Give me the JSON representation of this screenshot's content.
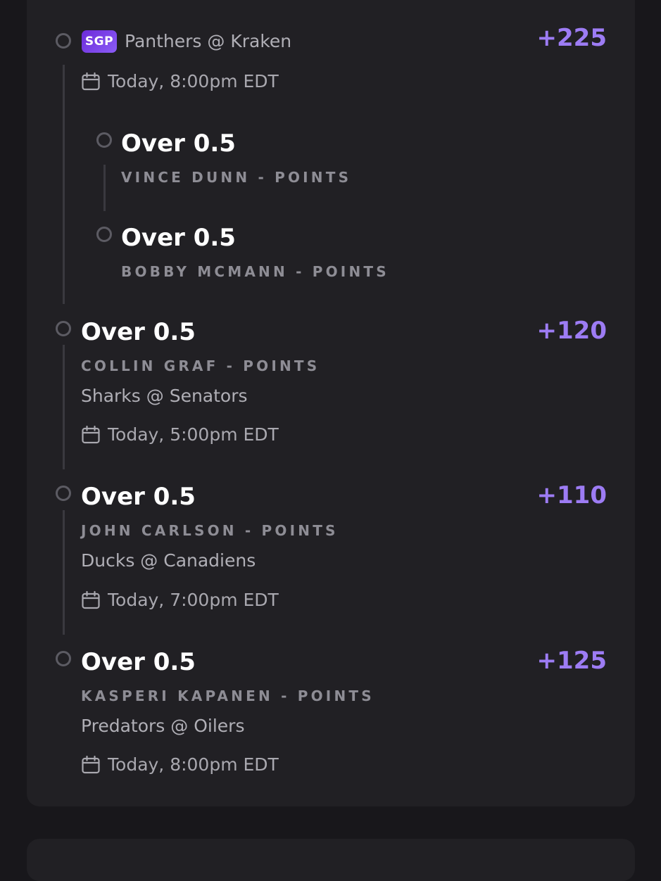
{
  "parlay": {
    "tag": "SGP",
    "event": "Panthers @ Kraken",
    "odds": "+225",
    "datetime": "Today, 8:00pm EDT",
    "legs": [
      {
        "title": "Over 0.5",
        "player": "VINCE DUNN - POINTS"
      },
      {
        "title": "Over 0.5",
        "player": "BOBBY MCMANN - POINTS"
      }
    ]
  },
  "bets": [
    {
      "title": "Over 0.5",
      "odds": "+120",
      "player": "COLLIN GRAF - POINTS",
      "event": "Sharks @ Senators",
      "datetime": "Today, 5:00pm EDT"
    },
    {
      "title": "Over 0.5",
      "odds": "+110",
      "player": "JOHN CARLSON - POINTS",
      "event": "Ducks @ Canadiens",
      "datetime": "Today, 7:00pm EDT"
    },
    {
      "title": "Over 0.5",
      "odds": "+125",
      "player": "KASPERI KAPANEN - POINTS",
      "event": "Predators @ Oilers",
      "datetime": "Today, 8:00pm EDT"
    }
  ],
  "icons": {
    "status": "circle-icon",
    "calendar": "calendar-icon"
  },
  "colors": {
    "accent": "#9d7cf4",
    "sgp_badge": "#7c3aed",
    "card": "#212024",
    "background": "#18171b"
  }
}
